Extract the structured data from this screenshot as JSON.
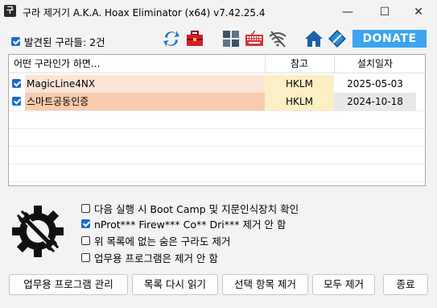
{
  "window": {
    "icon_glyph": "구",
    "title": "구라 제거기 A.K.A. Hoax Eliminator (x64) v7.42.25.4",
    "minimize_glyph": "—",
    "maximize_glyph": "☐",
    "close_glyph": "✕"
  },
  "toolbar": {
    "found_checkbox_checked": true,
    "found_label": "발견된 구라들: 2건",
    "icons": [
      "refresh-icon",
      "toolbox-icon",
      "windows-icon",
      "keyboard-icon",
      "wifi-off-icon",
      "home-icon",
      "diamond-icon"
    ],
    "donate_label": "DONATE",
    "accent_color": "#3ba3f0"
  },
  "list": {
    "columns": [
      "어떤 구라인가 하면...",
      "참고",
      "설치일자"
    ],
    "rows": [
      {
        "checked": true,
        "name": "MagicLine4NX",
        "ref": "HKLM",
        "date": "2025-05-03",
        "bg": "#fbe5d6"
      },
      {
        "checked": true,
        "name": "스마트공동인증",
        "ref": "HKLM",
        "date": "2024-10-18",
        "bg": "#f8cbad"
      }
    ]
  },
  "options": [
    {
      "checked": false,
      "label": "다음 실행 시 Boot Camp 및 지문인식장치 확인"
    },
    {
      "checked": true,
      "label": "nProt*** Firew*** Co** Dri*** 제거 안 함"
    },
    {
      "checked": false,
      "label": "위 목록에 없는 숨은 구라도 제거"
    },
    {
      "checked": false,
      "label": "업무용 프로그램은 제거 안 함"
    }
  ],
  "buttons": {
    "manage": "업무용 프로그램 관리",
    "reload": "목록 다시 읽기",
    "remove_selected": "선택 항목 제거",
    "remove_all": "모두 제거",
    "exit": "종료"
  }
}
